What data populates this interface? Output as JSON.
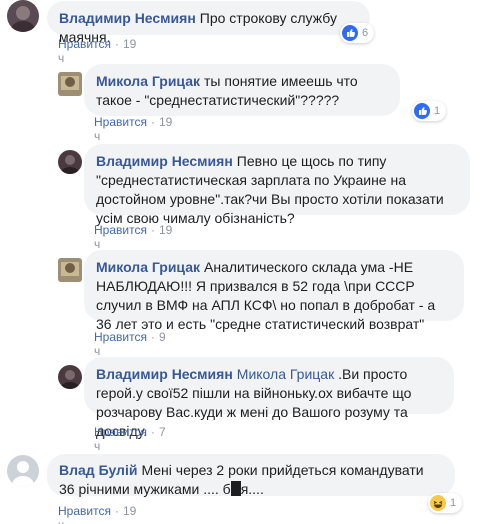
{
  "comments": [
    {
      "author": "Владимир Несмиян",
      "text": "Про строкову службу маячня.",
      "like_label": "Нравится",
      "age": "19 ч",
      "reaction_count": "6"
    },
    {
      "author": "Микола Грицак",
      "text": "ты понятие имеешь что такое - \"среднестатистический\"?????",
      "like_label": "Нравится",
      "age": "19 ч",
      "reaction_count": "1"
    },
    {
      "author": "Владимир Несмиян",
      "text": "Певно це щось по типу \"среднестатистическая зарплата по Украине на достойном уровне\".так?чи Вы просто хотіли показати усім свою чималу обізнаність?",
      "like_label": "Нравится",
      "age": "19 ч"
    },
    {
      "author": "Микола Грицак",
      "text": "Аналитического склада ума -НЕ НАБЛЮДАЮ!!! Я призвался в 52 года \\при СССР случил в ВМФ на АПЛ КСФ\\ но попал в добробат - а 36 лет это и есть \"средне статистический возврат\"",
      "like_label": "Нравится",
      "age": "9 ч"
    },
    {
      "author": "Владимир Несмиян",
      "mention": "Микола Грицак",
      "text": ".Ви просто герой.у свої52 пішли на війноньку.ох вибачте що розчарову Вас.куди ж мені до Вашого розуму та досвіду.",
      "like_label": "Нравится",
      "age": "7 ч"
    },
    {
      "author": "Влад Булій",
      "text_before": "Мені через 2 роки прийдеться командувати 36 річними мужиками .... б",
      "text_after": "я....",
      "like_label": "Нравится",
      "age": "19 ч",
      "reaction_count": "1"
    }
  ],
  "separator": "·"
}
